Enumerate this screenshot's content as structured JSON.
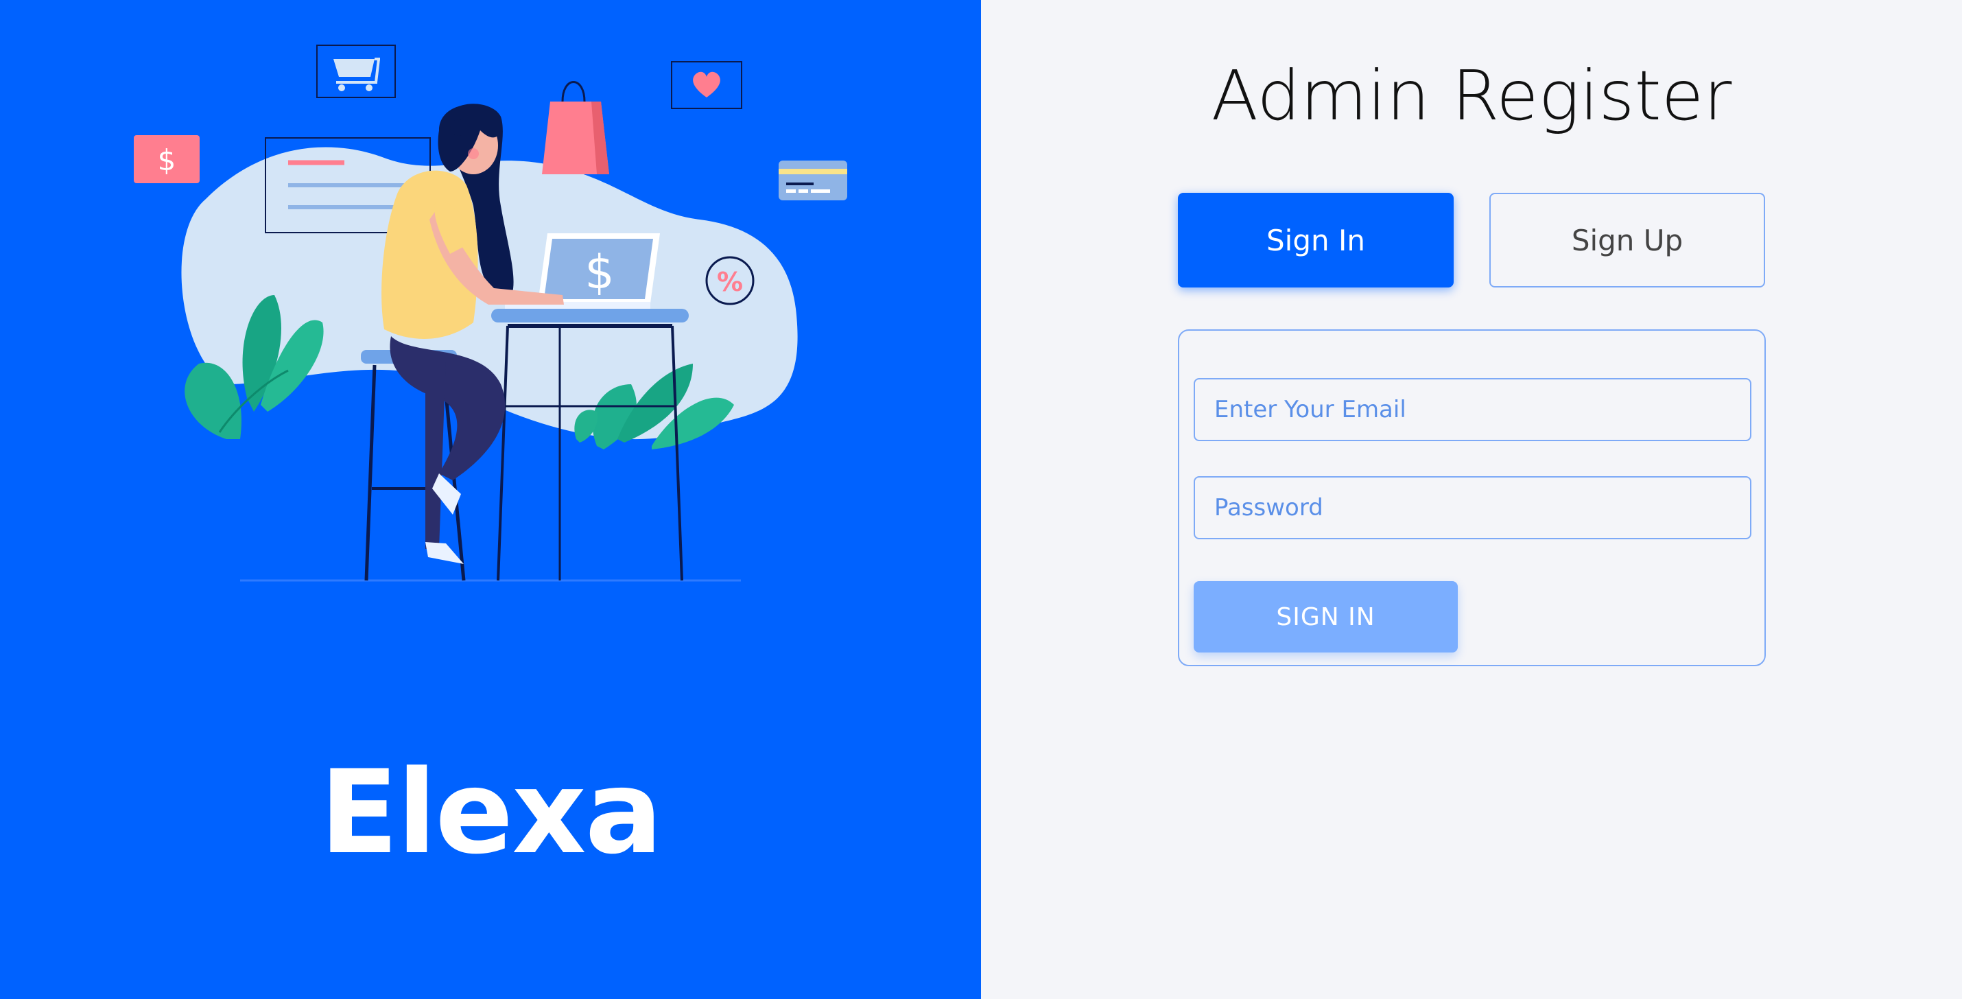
{
  "brand": {
    "name": "Elexa"
  },
  "header": {
    "title": "Admin Register"
  },
  "tabs": {
    "sign_in_label": "Sign In",
    "sign_up_label": "Sign Up",
    "active": "Sign In"
  },
  "form": {
    "email_placeholder": "Enter Your Email",
    "email_value": "",
    "password_placeholder": "Password",
    "password_value": "",
    "submit_label": "SIGN IN"
  },
  "illustration": {
    "laptop_symbol": "$",
    "card_symbol": "$",
    "discount_symbol": "%"
  },
  "colors": {
    "primary": "#0062FF",
    "background_right": "#F4F5F9",
    "submit_button": "#7BAEFF",
    "border": "#7EAAF7",
    "accent_pink": "#FF7E8F"
  },
  "icons": [
    "shopping-cart-icon",
    "shopping-bag-icon",
    "heart-icon",
    "dollar-card-icon",
    "credit-card-icon",
    "percent-icon"
  ]
}
